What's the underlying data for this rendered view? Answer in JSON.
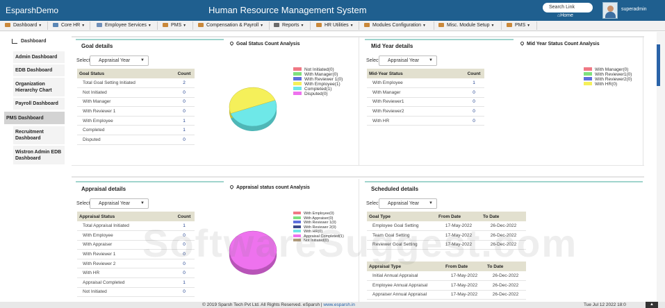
{
  "header": {
    "brand": "EsparshDemo",
    "title": "Human Resource Management System",
    "search_placeholder": "Search Link",
    "home_label": "Home",
    "username": "superadmin"
  },
  "menu": [
    {
      "label": "Dashboard",
      "icon": "folder-icon",
      "color": "#c9883a"
    },
    {
      "label": "Core HR",
      "icon": "org-icon",
      "color": "#5a86b5"
    },
    {
      "label": "Employee Services",
      "icon": "gear-icon",
      "color": "#6f8fb8"
    },
    {
      "label": "PMS",
      "icon": "folder-icon",
      "color": "#c9883a"
    },
    {
      "label": "Compensation & Payroll",
      "icon": "folder-icon",
      "color": "#c9883a"
    },
    {
      "label": "Reports",
      "icon": "chart-icon",
      "color": "#6a6a6a"
    },
    {
      "label": "HR Utilities",
      "icon": "folder-icon",
      "color": "#c9883a"
    },
    {
      "label": "Modules Configuration",
      "icon": "folder-icon",
      "color": "#c9883a"
    },
    {
      "label": "Misc. Module Setup",
      "icon": "folder-icon",
      "color": "#c9883a"
    },
    {
      "label": "PMS",
      "icon": "folder-icon",
      "color": "#c9883a"
    }
  ],
  "sidebar": {
    "heading": "Dashboard",
    "items": [
      {
        "label": "Admin Dashboard"
      },
      {
        "label": "EDB Dashboard"
      },
      {
        "label": "Organization Hierarchy Chart"
      },
      {
        "label": "Payroll Dashboard"
      },
      {
        "label": "PMS Dashboard"
      },
      {
        "label": "Recruitment Dashboard"
      },
      {
        "label": "Wistron Admin EDB Dashboard"
      }
    ]
  },
  "goal": {
    "title": "Goal details",
    "select_label": "Select",
    "select_value": "Appraisal Year",
    "col1": "Goal Status",
    "col2": "Count",
    "rows": [
      {
        "name": "Total Goal Setting Initiated",
        "count": "2"
      },
      {
        "name": "Not Initiated",
        "count": "0"
      },
      {
        "name": "With Manager",
        "count": "0"
      },
      {
        "name": "With Reviewer 1",
        "count": "0"
      },
      {
        "name": "With Employee",
        "count": "1"
      },
      {
        "name": "Completed",
        "count": "1"
      },
      {
        "name": "Disputed",
        "count": "0"
      }
    ]
  },
  "goal_chart": {
    "title": "Goal Status Count Analysis",
    "legend": [
      {
        "label": "Not Initiated(0)",
        "color": "#f07884"
      },
      {
        "label": "With Manager(0)",
        "color": "#7ee07e"
      },
      {
        "label": "With Reviewer 1(0)",
        "color": "#5e6fdc"
      },
      {
        "label": "With Employee(1)",
        "color": "#f5f05a"
      },
      {
        "label": "Completed(1)",
        "color": "#6ee8e8"
      },
      {
        "label": "Disputed(0)",
        "color": "#ee72ee"
      }
    ],
    "slices": [
      {
        "value": 1,
        "color": "#6ee8e8",
        "side": "#4fb7b7"
      },
      {
        "value": 1,
        "color": "#f5f05a",
        "side": "#c4bf3d"
      }
    ]
  },
  "midyear": {
    "title": "Mid Year details",
    "select_label": "Select",
    "select_value": "Appraisal Year",
    "col1": "Mid-Year Status",
    "col2": "Count",
    "rows": [
      {
        "name": "With Employee",
        "count": "1"
      },
      {
        "name": "With Manager",
        "count": "0"
      },
      {
        "name": "With Reviewer1",
        "count": "0"
      },
      {
        "name": "With Reviewer2",
        "count": "0"
      },
      {
        "name": "With HR",
        "count": "0"
      }
    ]
  },
  "midyear_chart": {
    "title": "Mid Year Status Count Analysis",
    "legend": [
      {
        "label": "With Manager(0)",
        "color": "#f07884"
      },
      {
        "label": "With Reviewer1(0)",
        "color": "#7ee07e"
      },
      {
        "label": "With Reviewer2(0)",
        "color": "#5e6fdc"
      },
      {
        "label": "With HR(0)",
        "color": "#f5f05a"
      }
    ]
  },
  "appraisal": {
    "title": "Appraisal details",
    "select_label": "Select",
    "select_value": "Appraisal Year",
    "col1": "Appraisal Status",
    "col2": "Count",
    "rows": [
      {
        "name": "Total Appraisal Initiated",
        "count": "1"
      },
      {
        "name": "With Employee",
        "count": "0"
      },
      {
        "name": "With Appraiser",
        "count": "0"
      },
      {
        "name": "With Reviewer 1",
        "count": "0"
      },
      {
        "name": "With Reviewer 2",
        "count": "0"
      },
      {
        "name": "With HR",
        "count": "0"
      },
      {
        "name": "Appraisal Completed",
        "count": "1"
      },
      {
        "name": "Not Initiated",
        "count": "0"
      }
    ]
  },
  "appraisal_chart": {
    "title": "Appraisal status count Analysis",
    "legend": [
      {
        "label": "With Employee(0)",
        "color": "#f07884"
      },
      {
        "label": "With Appraiser(0)",
        "color": "#7ee07e"
      },
      {
        "label": "With Reviewer 1(0)",
        "color": "#5e6fdc"
      },
      {
        "label": "With Reviewer 2(0)",
        "color": "#3d4a8a"
      },
      {
        "label": "With HR(0)",
        "color": "#6ee8e8"
      },
      {
        "label": "Appraisal Completed(1)",
        "color": "#ee72ee"
      },
      {
        "label": "Not Initiated(0)",
        "color": "#b09a7a"
      }
    ],
    "slices": [
      {
        "value": 1,
        "color": "#ee72ee",
        "side": "#b854b8"
      }
    ]
  },
  "scheduled": {
    "title": "Scheduled details",
    "select_label": "Select",
    "select_value": "Appraisal Year",
    "goal_cols": [
      "Goal Type",
      "From Date",
      "To Date"
    ],
    "goal_rows": [
      {
        "type": "Employee Goal Setting",
        "from": "17-May-2022",
        "to": "26-Dec-2022"
      },
      {
        "type": "Team Goal Setting",
        "from": "17-May-2022",
        "to": "26-Dec-2022"
      },
      {
        "type": "Reviewer Goal Setting",
        "from": "17-May-2022",
        "to": "26-Dec-2022"
      }
    ],
    "appraisal_cols": [
      "Appraisal Type",
      "From Date",
      "To Date"
    ],
    "appraisal_rows": [
      {
        "type": "Initial Annual Appraisal",
        "from": "17-May-2022",
        "to": "26-Dec-2022"
      },
      {
        "type": "Employee Annual Appraisal",
        "from": "17-May-2022",
        "to": "26-Dec-2022"
      },
      {
        "type": "Appraiser Annual Appraisal",
        "from": "17-May-2022",
        "to": "26-Dec-2022"
      }
    ]
  },
  "watermark": "SoftwareSuggest.com",
  "footer": {
    "copyright": "© 2019 Sparsh Tech Pvt Ltd. All Rights Reserved. eSparsh | ",
    "link": "www.esparsh.in",
    "datetime": "Tue Jul 12 2022 18:0",
    "corner": "▲"
  }
}
